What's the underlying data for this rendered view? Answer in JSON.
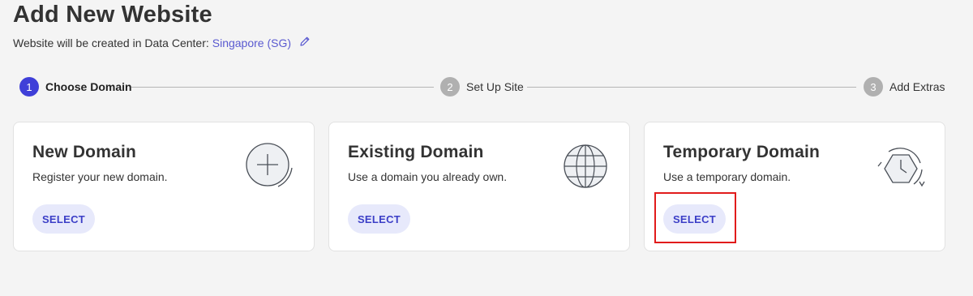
{
  "header": {
    "title": "Add New Website",
    "subtitle_prefix": "Website will be created in Data Center:",
    "data_center": "Singapore (SG)"
  },
  "steps": [
    {
      "num": "1",
      "label": "Choose Domain",
      "active": true
    },
    {
      "num": "2",
      "label": "Set Up Site",
      "active": false
    },
    {
      "num": "3",
      "label": "Add Extras",
      "active": false
    }
  ],
  "cards": [
    {
      "title": "New Domain",
      "desc": "Register your new domain.",
      "button": "SELECT",
      "icon": "plus-circle-icon"
    },
    {
      "title": "Existing Domain",
      "desc": "Use a domain you already own.",
      "button": "SELECT",
      "icon": "globe-icon"
    },
    {
      "title": "Temporary Domain",
      "desc": "Use a temporary domain.",
      "button": "SELECT",
      "icon": "clock-hexagon-icon"
    }
  ],
  "colors": {
    "accent": "#3f3fd8",
    "button_bg": "#e7e9fb",
    "highlight": "#e11b1b"
  }
}
